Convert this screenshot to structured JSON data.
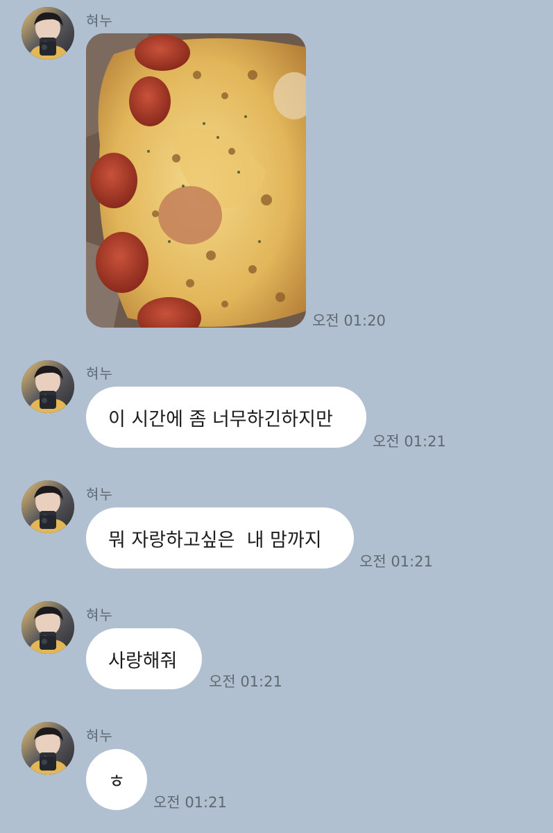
{
  "chat": {
    "messages": [
      {
        "sender": "혀누",
        "type": "image",
        "image_desc": "pizza-photo",
        "time": "오전 01:20"
      },
      {
        "sender": "혀누",
        "type": "text",
        "text": "이 시간에 좀 너무하긴하지만",
        "time": "오전 01:21"
      },
      {
        "sender": "혀누",
        "type": "text",
        "text": "뭐 자랑하고싶은  내 맘까지",
        "time": "오전 01:21"
      },
      {
        "sender": "혀누",
        "type": "text",
        "text": "사랑해줘",
        "time": "오전 01:21"
      },
      {
        "sender": "혀누",
        "type": "text",
        "text": "ㅎ",
        "time": "오전 01:21"
      }
    ]
  },
  "colors": {
    "background": "#b1c0d0",
    "bubble": "#ffffff",
    "meta_text": "#5f6770"
  }
}
